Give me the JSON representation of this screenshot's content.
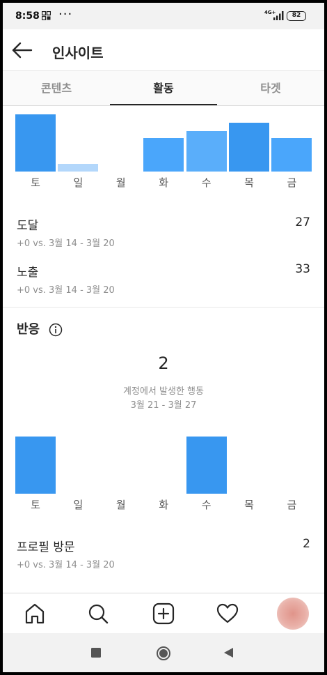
{
  "status_bar": {
    "time": "8:58",
    "dots": "···",
    "network": "4G+",
    "battery": "82"
  },
  "header": {
    "title": "인사이트",
    "back_icon": "arrow-left-icon"
  },
  "tabs": [
    {
      "label": "콘텐츠",
      "active": false
    },
    {
      "label": "활동",
      "active": true
    },
    {
      "label": "타겟",
      "active": false
    }
  ],
  "reach_chart": {
    "days": [
      "토",
      "일",
      "월",
      "화",
      "수",
      "목",
      "금"
    ]
  },
  "metrics": [
    {
      "label": "도달",
      "value": "27",
      "sub": "+0 vs. 3월 14 - 3월 20"
    },
    {
      "label": "노출",
      "value": "33",
      "sub": "+0 vs. 3월 14 - 3월 20"
    }
  ],
  "interactions": {
    "title": "반응",
    "total": "2",
    "caption": "계정에서 발생한 행동",
    "date_range": "3월 21 - 3월 27",
    "days": [
      "토",
      "일",
      "월",
      "화",
      "수",
      "목",
      "금"
    ]
  },
  "profile_visits": {
    "label": "프로필 방문",
    "value": "2",
    "sub": "+0 vs. 3월 14 - 3월 20"
  },
  "chart_data": [
    {
      "type": "bar",
      "categories": [
        "토",
        "일",
        "월",
        "화",
        "수",
        "목",
        "금"
      ],
      "values": [
        10,
        1.4,
        0,
        5.8,
        7.1,
        8.5,
        5.8
      ],
      "colors": [
        "#3897f0",
        "#b3d7fb",
        "#3897f0",
        "#4aa6fb",
        "#5aaefa",
        "#3897f0",
        "#4aa6fb"
      ]
    },
    {
      "type": "bar",
      "categories": [
        "토",
        "일",
        "월",
        "화",
        "수",
        "목",
        "금"
      ],
      "values": [
        1,
        0,
        0,
        0,
        1,
        0,
        0
      ],
      "colors": [
        "#3897f0",
        "#3897f0",
        "#3897f0",
        "#3897f0",
        "#3897f0",
        "#3897f0",
        "#3897f0"
      ]
    }
  ],
  "bottom_nav": [
    {
      "icon": "home-icon"
    },
    {
      "icon": "search-icon"
    },
    {
      "icon": "add-post-icon"
    },
    {
      "icon": "heart-icon"
    },
    {
      "icon": "profile-avatar"
    }
  ],
  "android_nav": [
    {
      "icon": "recent-apps-icon"
    },
    {
      "icon": "home-circle-icon"
    },
    {
      "icon": "back-triangle-icon"
    }
  ]
}
